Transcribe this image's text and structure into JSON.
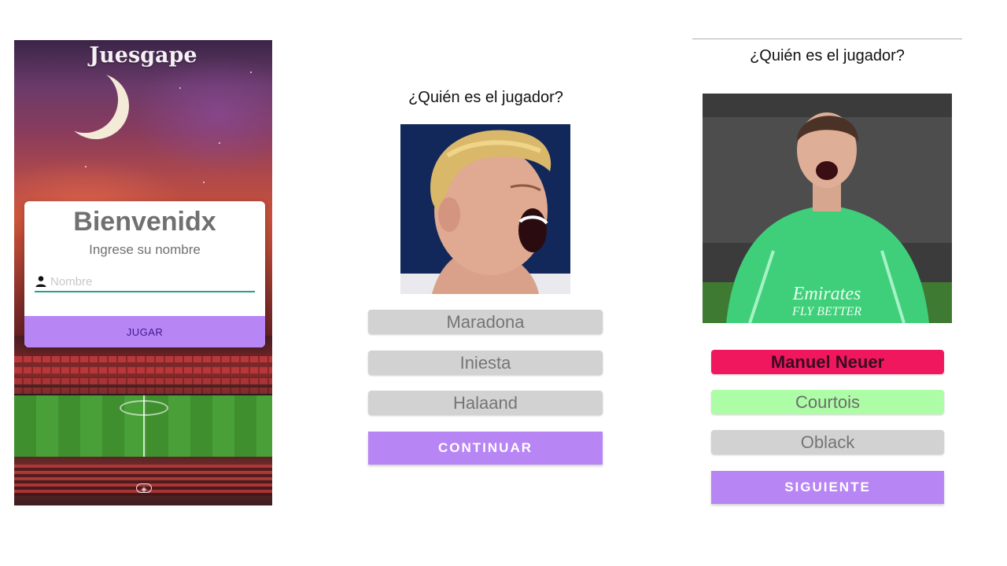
{
  "login": {
    "app_title": "Juesgape",
    "welcome": "Bienvenidx",
    "subtitle": "Ingrese su nombre",
    "name_placeholder": "Nombre",
    "play_label": "JUGAR",
    "icons": [
      "moon-icon",
      "person-icon"
    ]
  },
  "quiz1": {
    "question": "¿Quién es el jugador?",
    "options": [
      {
        "label": "Maradona"
      },
      {
        "label": "Iniesta"
      },
      {
        "label": "Halaand"
      }
    ],
    "continue_label": "CONTINUAR"
  },
  "quiz2": {
    "question": "¿Quién es el jugador?",
    "options": [
      {
        "label": "Manuel Neuer",
        "state": "wrong"
      },
      {
        "label": "Courtois",
        "state": "correct"
      },
      {
        "label": "Oblack",
        "state": "neutral"
      }
    ],
    "next_label": "SIGUIENTE"
  },
  "colors": {
    "primary": "#b885f5",
    "option_neutral": "#d2d2d2",
    "option_wrong": "#f0175f",
    "option_correct": "#adfda6",
    "field_underline": "#2a9d8f"
  }
}
